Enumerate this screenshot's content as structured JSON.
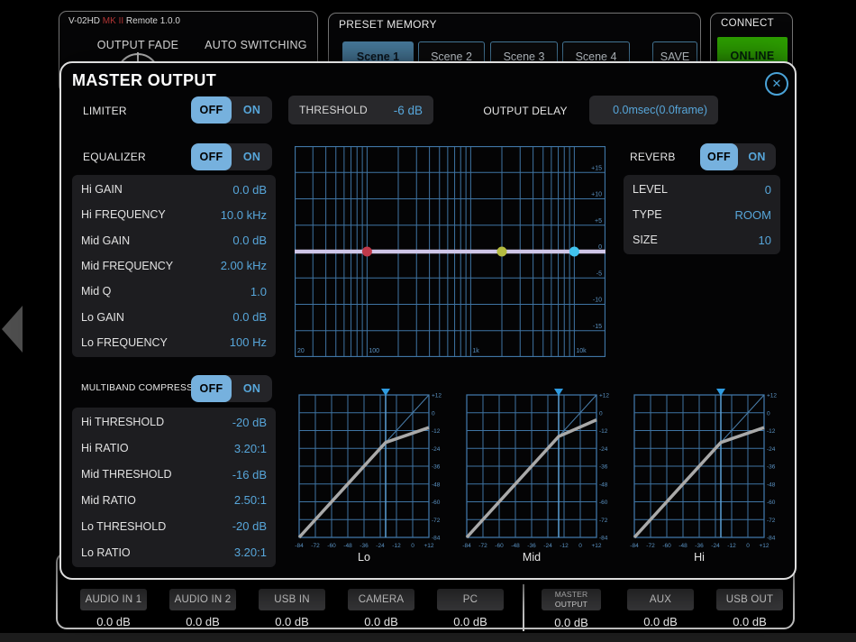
{
  "header": {
    "device": "V-02HD",
    "device_mk": "MK II",
    "device_rest": "Remote 1.0.0",
    "output_fade": "OUTPUT FADE",
    "auto_switching": "AUTO SWITCHING",
    "preset_memory": {
      "title": "PRESET MEMORY",
      "scenes": [
        "Scene 1",
        "Scene 2",
        "Scene 3",
        "Scene 4"
      ],
      "save": "SAVE",
      "active_scene": "Scene 1"
    },
    "connect": {
      "title": "CONNECT",
      "status": "ONLINE",
      "status_color": "#2ea301"
    }
  },
  "modal": {
    "title": "MASTER OUTPUT",
    "close": "✕",
    "limiter": {
      "label": "LIMITER",
      "off": "OFF",
      "on": "ON",
      "state": "OFF",
      "threshold": {
        "label": "THRESHOLD",
        "value": "-6 dB"
      },
      "output_delay": {
        "label": "OUTPUT DELAY",
        "value": "0.0msec(0.0frame)"
      }
    },
    "equalizer": {
      "label": "EQUALIZER",
      "off": "OFF",
      "on": "ON",
      "state": "OFF",
      "params": [
        {
          "label": "Hi GAIN",
          "value": "0.0 dB"
        },
        {
          "label": "Hi FREQUENCY",
          "value": "10.0 kHz"
        },
        {
          "label": "Mid GAIN",
          "value": "0.0 dB"
        },
        {
          "label": "Mid FREQUENCY",
          "value": "2.00 kHz"
        },
        {
          "label": "Mid Q",
          "value": "1.0"
        },
        {
          "label": "Lo GAIN",
          "value": "0.0 dB"
        },
        {
          "label": "Lo FREQUENCY",
          "value": "100 Hz"
        }
      ]
    },
    "reverb": {
      "label": "REVERB",
      "off": "OFF",
      "on": "ON",
      "state": "OFF",
      "params": [
        {
          "label": "LEVEL",
          "value": "0"
        },
        {
          "label": "TYPE",
          "value": "ROOM"
        },
        {
          "label": "SIZE",
          "value": "10"
        }
      ]
    },
    "multiband_compressor": {
      "label": "MULTIBAND COMPRESSOR",
      "off": "OFF",
      "on": "ON",
      "state": "OFF",
      "params": [
        {
          "label": "Hi THRESHOLD",
          "value": "-20 dB"
        },
        {
          "label": "Hi RATIO",
          "value": "3.20:1"
        },
        {
          "label": "Mid THRESHOLD",
          "value": "-16 dB"
        },
        {
          "label": "Mid RATIO",
          "value": "2.50:1"
        },
        {
          "label": "Lo THRESHOLD",
          "value": "-20 dB"
        },
        {
          "label": "Lo RATIO",
          "value": "3.20:1"
        }
      ]
    }
  },
  "chart_data": [
    {
      "type": "line",
      "name": "eq-frequency-response",
      "x_scale": "log",
      "x_range_hz": [
        20,
        20000
      ],
      "x_ticks": [
        {
          "hz": 20,
          "label": "20"
        },
        {
          "hz": 100,
          "label": "100"
        },
        {
          "hz": 1000,
          "label": "1k"
        },
        {
          "hz": 10000,
          "label": "10k"
        }
      ],
      "y_range_db": [
        -20,
        20
      ],
      "y_grid_step_db": 5,
      "y_ticks": [
        {
          "db": 15,
          "label": "+15"
        },
        {
          "db": 10,
          "label": "+10"
        },
        {
          "db": 5,
          "label": "+5"
        },
        {
          "db": 0,
          "label": "0"
        },
        {
          "db": -5,
          "label": "-5"
        },
        {
          "db": -10,
          "label": "-10"
        },
        {
          "db": -15,
          "label": "-15"
        }
      ],
      "response_db": 0,
      "bands": [
        {
          "name": "lo",
          "freq_hz": 100,
          "gain_db": 0,
          "color": "#c0394a"
        },
        {
          "name": "mid",
          "freq_hz": 2000,
          "gain_db": 0,
          "color": "#b4bb40"
        },
        {
          "name": "hi",
          "freq_hz": 10000,
          "gain_db": 0,
          "color": "#41c3ef"
        }
      ],
      "grid_color": "#3f74a3",
      "tick_color": "#5b93c4",
      "curve_color": "#cfc6e8"
    },
    {
      "type": "line",
      "name": "compressor-curve-lo",
      "title": "Lo",
      "range_db": [
        -84,
        12
      ],
      "grid_step_db": 12,
      "x_tick_labels": [
        "-84",
        "-72",
        "-60",
        "-48",
        "-36",
        "-24",
        "-12",
        "0",
        "+12"
      ],
      "y_tick_labels": [
        "+12",
        "0",
        "-12",
        "-24",
        "-36",
        "-48",
        "-60",
        "-72",
        "-84"
      ],
      "threshold_db": -20,
      "ratio": "3.20:1",
      "curve_points_db": [
        [
          -84,
          -84
        ],
        [
          -20,
          -20
        ],
        [
          12,
          -10
        ]
      ],
      "grid_color": "#3f74a3",
      "tick_color": "#5b93c4",
      "curve_color": "#a9a9a9",
      "diagonal_color": "#4a7fac",
      "threshold_line_color": "#5b9fd4",
      "marker_color": "#2f9be0"
    },
    {
      "type": "line",
      "name": "compressor-curve-mid",
      "title": "Mid",
      "range_db": [
        -84,
        12
      ],
      "grid_step_db": 12,
      "x_tick_labels": [
        "-84",
        "-72",
        "-60",
        "-48",
        "-36",
        "-24",
        "-12",
        "0",
        "+12"
      ],
      "y_tick_labels": [
        "+12",
        "0",
        "-12",
        "-24",
        "-36",
        "-48",
        "-60",
        "-72",
        "-84"
      ],
      "threshold_db": -16,
      "ratio": "2.50:1",
      "curve_points_db": [
        [
          -84,
          -84
        ],
        [
          -16,
          -16
        ],
        [
          12,
          -4.8
        ]
      ],
      "grid_color": "#3f74a3",
      "tick_color": "#5b93c4",
      "curve_color": "#a9a9a9",
      "diagonal_color": "#4a7fac",
      "threshold_line_color": "#5b9fd4",
      "marker_color": "#2f9be0"
    },
    {
      "type": "line",
      "name": "compressor-curve-hi",
      "title": "Hi",
      "range_db": [
        -84,
        12
      ],
      "grid_step_db": 12,
      "x_tick_labels": [
        "-84",
        "-72",
        "-60",
        "-48",
        "-36",
        "-24",
        "-12",
        "0",
        "+12"
      ],
      "y_tick_labels": [
        "+12",
        "0",
        "-12",
        "-24",
        "-36",
        "-48",
        "-60",
        "-72",
        "-84"
      ],
      "threshold_db": -20,
      "ratio": "3.20:1",
      "curve_points_db": [
        [
          -84,
          -84
        ],
        [
          -20,
          -20
        ],
        [
          12,
          -10
        ]
      ],
      "grid_color": "#3f74a3",
      "tick_color": "#5b93c4",
      "curve_color": "#a9a9a9",
      "diagonal_color": "#4a7fac",
      "threshold_line_color": "#5b9fd4",
      "marker_color": "#2f9be0"
    }
  ],
  "bottom_bar": {
    "channels": [
      {
        "label": "AUDIO IN 1",
        "value": "0.0 dB"
      },
      {
        "label": "AUDIO IN 2",
        "value": "0.0 dB"
      },
      {
        "label": "USB IN",
        "value": "0.0 dB"
      },
      {
        "label": "CAMERA",
        "value": "0.0 dB"
      },
      {
        "label": "PC",
        "value": "0.0 dB"
      },
      {
        "label": "MASTER OUTPUT",
        "value": "0.0 dB"
      },
      {
        "label": "AUX",
        "value": "0.0 dB"
      },
      {
        "label": "USB OUT",
        "value": "0.0 dB"
      }
    ]
  }
}
